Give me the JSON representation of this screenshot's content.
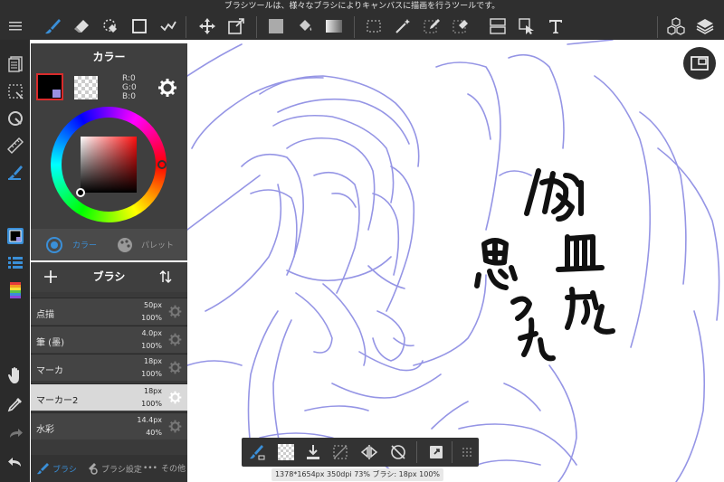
{
  "top_tip": "ブラシツールは、様々なブラシによりキャンバスに描画を行うツールです。",
  "color_panel": {
    "title": "カラー",
    "r_value": "R:0",
    "g_value": "G:0",
    "b_value": "B:0",
    "tab_color": "カラー",
    "tab_palette": "パレット"
  },
  "brush_panel": {
    "title": "ブラシ",
    "items": [
      {
        "name": "点描",
        "size": "50px",
        "opacity": "100%"
      },
      {
        "name": "筆 (墨)",
        "size": "4.0px",
        "opacity": "100%"
      },
      {
        "name": "マーカ",
        "size": "18px",
        "opacity": "100%"
      },
      {
        "name": "マーカー2",
        "size": "18px",
        "opacity": "100%"
      },
      {
        "name": "水彩",
        "size": "14.4px",
        "opacity": "40%"
      }
    ],
    "tab_brush": "ブラシ",
    "tab_settings": "ブラシ設定",
    "tab_other": "その他"
  },
  "status_bar": "1378*1654px 350dpi 73% ブラシ: 18px 100%",
  "colors": {
    "accent": "#3a8fd8",
    "toolbar_bg": "#2f2f2f",
    "panel_bg": "#3f3f3f",
    "sketch_line": "#7f7fe0",
    "selected_swatch_border": "#d82b2b"
  }
}
